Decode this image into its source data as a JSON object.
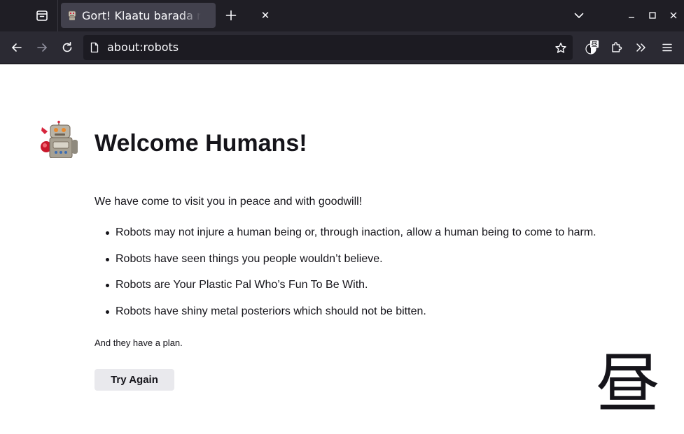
{
  "tab": {
    "title": "Gort! Klaatu barada nikto!",
    "close_glyph": "✕",
    "new_tab_glyph": "+"
  },
  "urlbar": {
    "url": "about:robots"
  },
  "page": {
    "title": "Welcome Humans!",
    "intro": "We have come to visit you in peace and with goodwill!",
    "rules": [
      "Robots may not injure a human being or, through inaction, allow a human being to come to harm.",
      "Robots have seen things you people wouldn’t believe.",
      "Robots are Your Plastic Pal Who’s Fun To Be With.",
      "Robots have shiny metal posteriors which should not be bitten."
    ],
    "plan": "And they have a plan.",
    "button_label": "Try Again"
  },
  "overlay": {
    "kanji": "昼"
  },
  "extension_badge": {
    "glyph": "昼"
  },
  "icons": {
    "tab_overview": "firefox-view-icon",
    "favicon": "robot-favicon-icon",
    "list_all_tabs": "chevron-down-icon",
    "minimize": "minimize-icon",
    "maximize": "maximize-icon",
    "close_window": "close-icon",
    "back": "back-arrow-icon",
    "forward": "forward-arrow-icon",
    "reload": "reload-icon",
    "page": "page-icon",
    "bookmark": "star-icon",
    "extension": "extension-icon",
    "extensions": "puzzle-icon",
    "overflow": "overflow-chevrons-icon",
    "menu": "hamburger-menu-icon"
  },
  "colors": {
    "tabbar_bg": "#1f1e25",
    "selected_tab_bg": "#42414d",
    "navbar_bg": "#2b2a33",
    "urlbar_bg": "#1c1b22",
    "page_bg": "#ffffff",
    "text": "#15141a",
    "button_bg": "#e9e9ed"
  }
}
